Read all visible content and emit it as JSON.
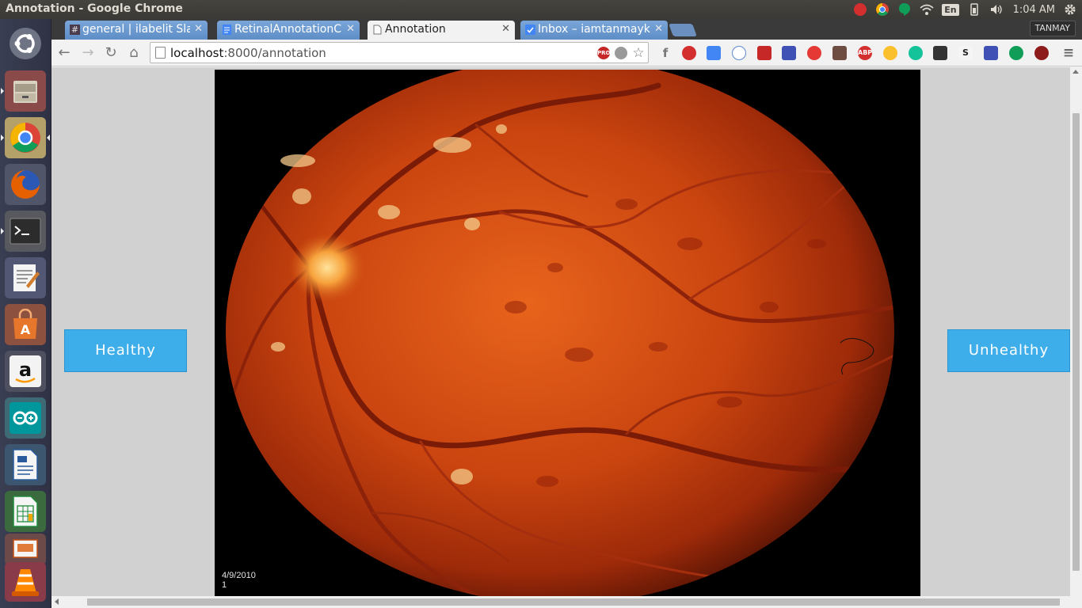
{
  "window": {
    "title": "Annotation - Google Chrome"
  },
  "tray": {
    "keyboard": "En",
    "clock": "1:04 AM"
  },
  "tabs": [
    {
      "label": "general | ilabelit Slac",
      "favicon": "#"
    },
    {
      "label": "RetinalAnnotationC",
      "favicon": "doc-icon"
    },
    {
      "label": "Annotation",
      "favicon": "page-icon"
    },
    {
      "label": "Inbox – iamtanmayk",
      "favicon": "mail-icon"
    }
  ],
  "profile": {
    "name": "TANMAY"
  },
  "address": {
    "host": "localhost",
    "path": ":8000/annotation",
    "pro_badge": "PRO"
  },
  "extensions": {
    "abp": "ABP"
  },
  "page": {
    "healthy_label": "Healthy",
    "unhealthy_label": "Unhealthy",
    "image_date": "4/9/2010",
    "image_index": "1"
  },
  "colors": {
    "button": "#3daee9",
    "page_bg": "#d1d1d1",
    "fundus": "#c8410f"
  }
}
